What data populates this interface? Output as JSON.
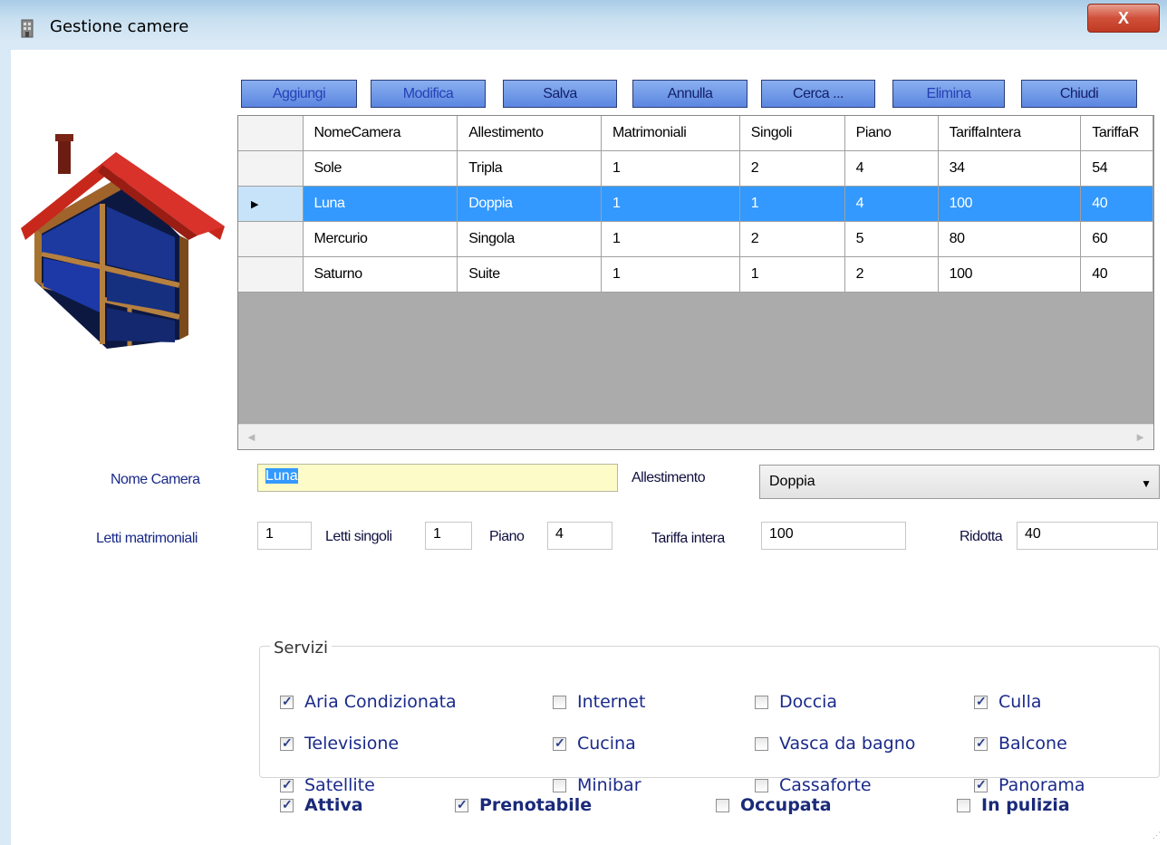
{
  "window": {
    "title": "Gestione camere",
    "close_glyph": "X"
  },
  "toolbar": [
    {
      "label": "Aggiungi",
      "enabled": false
    },
    {
      "label": "Modifica",
      "enabled": false
    },
    {
      "label": "Salva",
      "enabled": true
    },
    {
      "label": "Annulla",
      "enabled": true
    },
    {
      "label": "Cerca ...",
      "enabled": false
    },
    {
      "label": "Elimina",
      "enabled": false
    },
    {
      "label": "Chiudi",
      "enabled": true
    }
  ],
  "grid": {
    "columns": [
      "NomeCamera",
      "Allestimento",
      "Matrimoniali",
      "Singoli",
      "Piano",
      "TariffaIntera",
      "TariffaR"
    ],
    "rows": [
      [
        "Sole",
        "Tripla",
        "1",
        "2",
        "4",
        "34",
        "54"
      ],
      [
        "Luna",
        "Doppia",
        "1",
        "1",
        "4",
        "100",
        "40"
      ],
      [
        "Mercurio",
        "Singola",
        "1",
        "2",
        "5",
        "80",
        "60"
      ],
      [
        "Saturno",
        "Suite",
        "1",
        "1",
        "2",
        "100",
        "40"
      ]
    ],
    "selected_row": 1,
    "current_row_marker": "▶",
    "scroll_left": "◄",
    "scroll_right": "►"
  },
  "form": {
    "nome_camera_label": "Nome Camera",
    "nome_camera_value": "Luna",
    "allestimento_label": "Allestimento",
    "allestimento_value": "Doppia",
    "letti_matrimoniali_label": "Letti matrimoniali",
    "letti_matrimoniali_value": "1",
    "letti_singoli_label": "Letti singoli",
    "letti_singoli_value": "1",
    "piano_label": "Piano",
    "piano_value": "4",
    "tariffa_intera_label": "Tariffa intera",
    "tariffa_intera_value": "100",
    "ridotta_label": "Ridotta",
    "ridotta_value": "40"
  },
  "servizi": {
    "legend": "Servizi",
    "items": [
      {
        "label": "Aria Condizionata",
        "checked": true
      },
      {
        "label": "Internet",
        "checked": false
      },
      {
        "label": "Doccia",
        "checked": false
      },
      {
        "label": "Culla",
        "checked": true
      },
      {
        "label": "Televisione",
        "checked": true
      },
      {
        "label": "Cucina",
        "checked": true
      },
      {
        "label": "Vasca da bagno",
        "checked": false
      },
      {
        "label": "Balcone",
        "checked": true
      },
      {
        "label": "Satellite",
        "checked": true
      },
      {
        "label": "Minibar",
        "checked": false
      },
      {
        "label": "Cassaforte",
        "checked": false
      },
      {
        "label": "Panorama",
        "checked": true
      }
    ]
  },
  "status": [
    {
      "label": "Attiva",
      "checked": true
    },
    {
      "label": "Prenotabile",
      "checked": true
    },
    {
      "label": "Occupata",
      "checked": false
    },
    {
      "label": "In pulizia",
      "checked": false
    }
  ],
  "colors": {
    "selection": "#3399ff",
    "button_top": "#8ab0f0",
    "button_bottom": "#5b86e0",
    "label": "#1a2a8a"
  }
}
